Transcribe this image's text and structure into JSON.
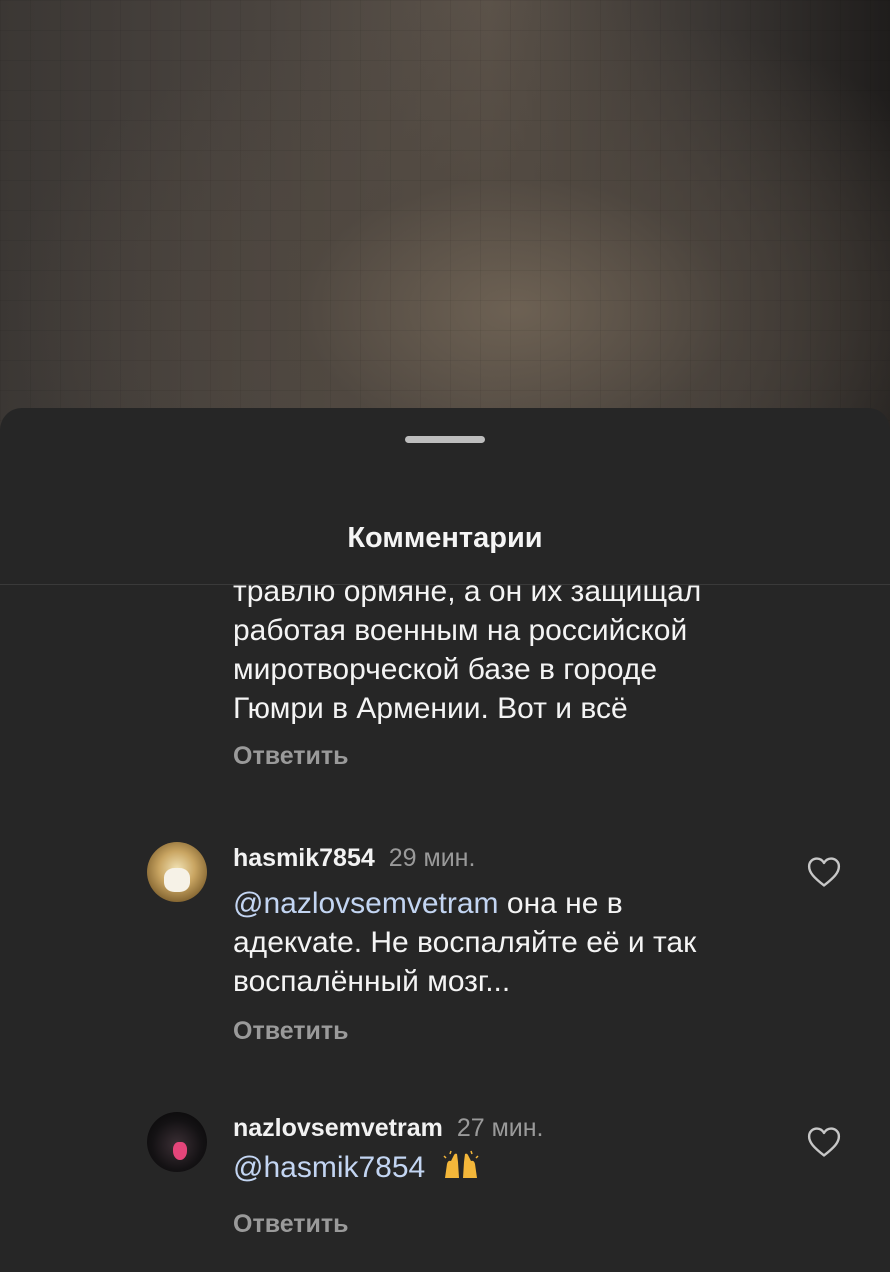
{
  "sheet": {
    "title": "Комментарии"
  },
  "comments": [
    {
      "text_lines": [
        "травлю ормяне, а он их защищал",
        "работая военным на российской",
        "миротворческой базе в городе",
        "Гюмри в Армении. Вот и всё"
      ],
      "reply_label": "Ответить"
    },
    {
      "username": "hasmik7854",
      "time": "29 мин.",
      "mention": "@nazlovsemvetram",
      "text_after_mention": " она не в",
      "text_lines": [
        "адекvate. Не воспаляйте её и так",
        "воспалённый мозг..."
      ],
      "reply_label": "Ответить",
      "like_icon": "heart-outline-icon",
      "avatar_icon": "avatar-image"
    },
    {
      "username": "nazlovsemvetram",
      "time": "27 мин.",
      "mention": "@hasmik7854",
      "emoji": "raising-hands-emoji",
      "reply_label": "Ответить",
      "like_icon": "heart-outline-icon",
      "avatar_icon": "avatar-image"
    }
  ],
  "colors": {
    "background": "#262626",
    "mention": "#c3d5f2",
    "secondary_text": "#9a9a9a"
  }
}
